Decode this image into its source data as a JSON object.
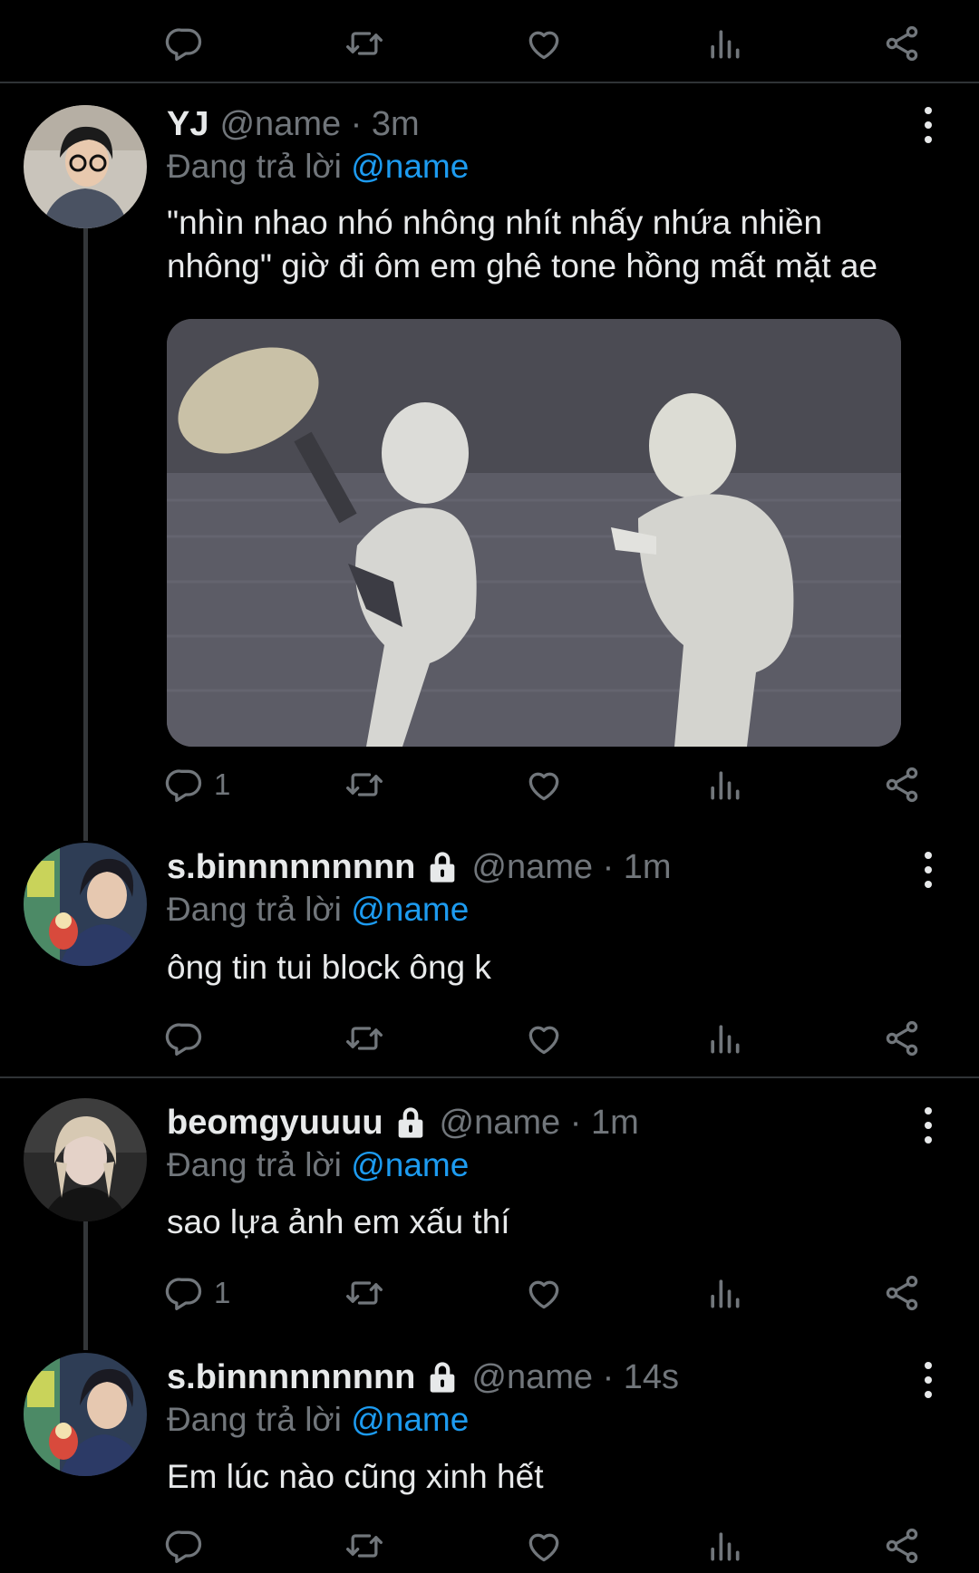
{
  "icons": {
    "reply": "reply-icon",
    "retweet": "retweet-icon",
    "like": "heart-icon",
    "views": "analytics-icon",
    "share": "share-icon",
    "more": "more-vertical-icon",
    "lock": "lock-icon"
  },
  "colors": {
    "background": "#000000",
    "text": "#e7e9ea",
    "muted": "#71767b",
    "mention": "#1d9bf0",
    "divider": "#2f3336"
  },
  "top_actions": {
    "reply_count": ""
  },
  "tweets": [
    {
      "name": "YJ",
      "locked": false,
      "meta": "@name · 3m",
      "reply_prefix": "Đang trả lời ",
      "reply_to": "@name",
      "text_line1": "\"nhìn nhao nhó nhông nhít nhấy nhứa nhiền",
      "text_line2": "nhông\" giờ đi ôm em ghê tone hồng mất mặt ae",
      "has_media": true,
      "reply_count": "1"
    },
    {
      "name": "s.binnnnnnnnn",
      "locked": true,
      "meta": "@name · 1m",
      "reply_prefix": "Đang trả lời ",
      "reply_to": "@name",
      "text": "ông tin tui block ông k",
      "reply_count": ""
    },
    {
      "name": "beomgyuuuu",
      "locked": true,
      "meta": "@name · 1m",
      "reply_prefix": "Đang trả lời ",
      "reply_to": "@name",
      "text": "sao lựa ảnh em xấu thí",
      "reply_count": "1"
    },
    {
      "name": "s.binnnnnnnnn",
      "locked": true,
      "meta": "@name · 14s",
      "reply_prefix": "Đang trả lời ",
      "reply_to": "@name",
      "text": "Em lúc nào cũng xinh hết",
      "reply_count": ""
    }
  ]
}
